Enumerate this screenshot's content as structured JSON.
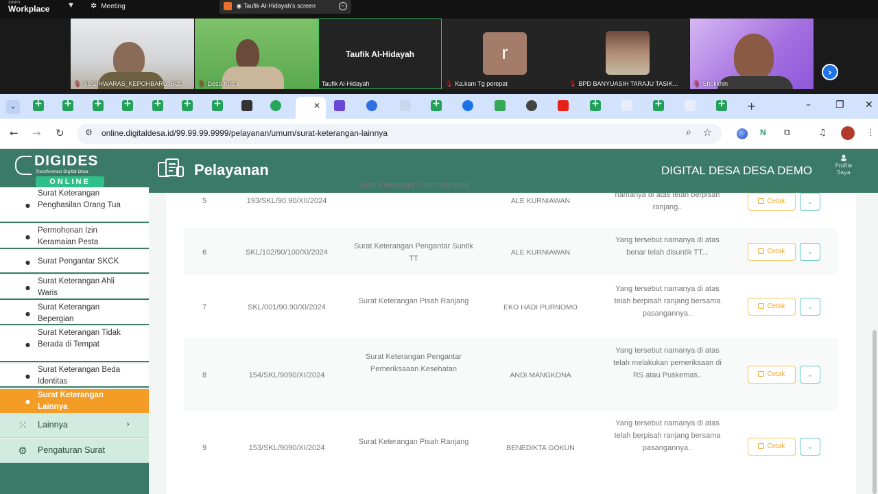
{
  "zoom": {
    "brand_small": "zoom",
    "brand": "Workplace",
    "meeting_label": "Meeting",
    "share_label": "Taufik Al-Hidayah's screen",
    "participants": [
      {
        "name": "SUGIHWARAS_KEPOHBARU_BOJ"
      },
      {
        "name": "Desa Kusu"
      },
      {
        "name": "Taufik Al-Hidayah",
        "center_name": "Taufik Al-Hidayah"
      },
      {
        "name": "Ka.kam Tg perepat",
        "initial": "r"
      },
      {
        "name": "BPD BANYUASIH TARAJU TASIK..."
      },
      {
        "name": "Sholikhin"
      }
    ]
  },
  "browser": {
    "url": "online.digitaldesa.id/99.99.99.9999/pelayanan/umum/surat-keterangan-lainnya"
  },
  "app": {
    "logo_name": "DIGIDES",
    "logo_tagline": "Transformasi Digital Desa",
    "logo_badge": "ONLINE",
    "header_title": "Pelayanan",
    "village": "DIGITAL DESA DESA DEMO",
    "profile_label": "Profile Saya"
  },
  "sidebar": {
    "submenu": [
      {
        "label": "Surat Keterangan Penghasilan Orang Tua"
      },
      {
        "label": "Permohonan Izin Keramaian Pesta"
      },
      {
        "label": "Surat Pengantar SKCK"
      },
      {
        "label": "Surat Keterangan Ahli Waris"
      },
      {
        "label": "Surat Keterangan Bepergian"
      },
      {
        "label": "Surat Keterangan Tidak Berada di Tempat"
      },
      {
        "label": "Surat Keterangan Beda Identitas"
      },
      {
        "label": "Surat Keterangan Lainnya",
        "active": true
      }
    ],
    "lainnya": "Lainnya",
    "pengaturan": "Pengaturan Surat"
  },
  "table": {
    "print_label": "Cetak",
    "rows": [
      {
        "no": "5",
        "nomor": "193/SKL/90.90/XII/2024",
        "jenis": "Surat Keterangan Pisah Ranjang",
        "nama": "ALE KURNIAWAN",
        "ket": "namanya di atas telah berpisah ranjang.."
      },
      {
        "no": "6",
        "nomor": "SKL/102/90/100/XI/2024",
        "jenis": "Surat Keterangan Pengantar Suntik TT",
        "nama": "ALE KURNIAWAN",
        "ket": "Yang tersebut namanya di atas benar telah disuntik TT..."
      },
      {
        "no": "7",
        "nomor": "SKL/001/90.90/XI/2024",
        "jenis": "Surat Keterangan Pisah Ranjang",
        "nama": "EKO HADI PURNOMO",
        "ket": "Yang tersebut namanya di atas telah berpisah ranjang bersama pasangannya.."
      },
      {
        "no": "8",
        "nomor": "154/SKL/9090/XI/2024",
        "jenis": "Surat Keterangan Pengantar Pemeriksaaan Kesehatan",
        "nama": "ANDI MANGKONA",
        "ket": "Yang tersebut namanya di atas telah melakukan pemeriksaan di RS atau Puskemas.."
      },
      {
        "no": "9",
        "nomor": "153/SKL/9090/XI/2024",
        "jenis": "Surat Keterangan Pisah Ranjang",
        "nama": "BENEDIKTA GOKUN",
        "ket": "Yang tersebut namanya di atas telah berpisah ranjang bersama pasangannya.."
      }
    ]
  }
}
